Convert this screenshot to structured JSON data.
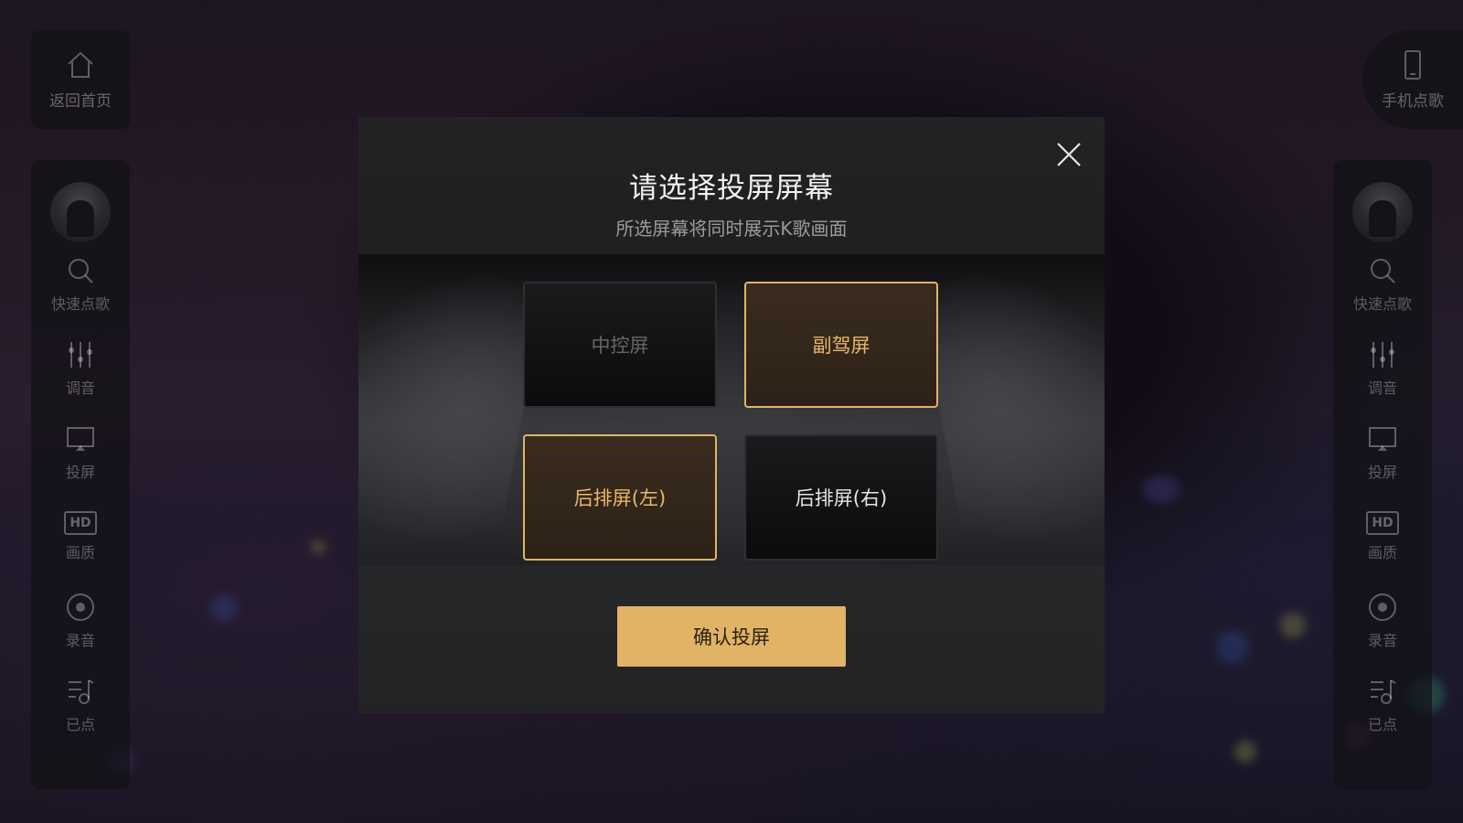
{
  "left_top": {
    "label": "返回首页",
    "icon": "home-icon"
  },
  "right_top": {
    "label": "手机点歌",
    "icon": "phone-icon"
  },
  "sidebar": {
    "items": [
      {
        "label": "快速点歌",
        "icon": "search-icon"
      },
      {
        "label": "调音",
        "icon": "equalizer-icon"
      },
      {
        "label": "投屏",
        "icon": "cast-screen-icon"
      },
      {
        "label": "画质",
        "icon": "hd-icon",
        "icon_text": "HD"
      },
      {
        "label": "录音",
        "icon": "record-icon"
      },
      {
        "label": "已点",
        "icon": "playlist-icon"
      }
    ]
  },
  "dialog": {
    "title": "请选择投屏屏幕",
    "subtitle": "所选屏幕将同时展示K歌画面",
    "options": [
      {
        "label": "中控屏",
        "state": "disabled"
      },
      {
        "label": "副驾屏",
        "state": "selected"
      },
      {
        "label": "后排屏(左)",
        "state": "selected"
      },
      {
        "label": "后排屏(右)",
        "state": "normal"
      }
    ],
    "confirm_label": "确认投屏",
    "close_icon": "close-icon"
  },
  "colors": {
    "accent": "#e0b366",
    "selected_text": "#e9b766",
    "selected_bg": "#33271b",
    "modal_bg": "#1f1f21"
  }
}
